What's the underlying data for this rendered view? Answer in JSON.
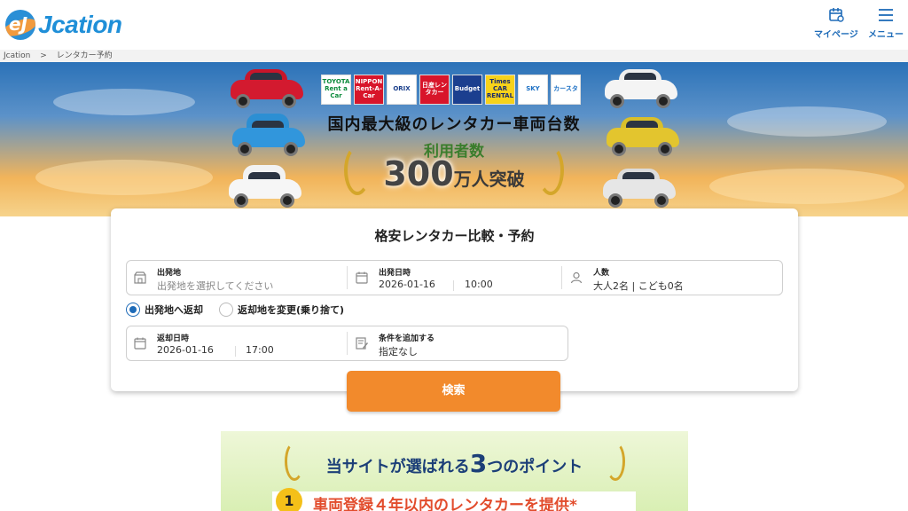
{
  "header": {
    "logo_mark": "eJ",
    "logo_text": "Jcation",
    "mypage_label": "マイページ",
    "menu_label": "メニュー"
  },
  "breadcrumb": {
    "home": "Jcation",
    "sep": ">",
    "current": "レンタカー予約"
  },
  "banner": {
    "brands": [
      "TOYOTA Rent a Car",
      "NIPPON Rent-A-Car",
      "ORIX",
      "日産レンタカー",
      "Budget",
      "Times CAR RENTAL",
      "SKY",
      "カースタ"
    ],
    "title": "国内最大級のレンタカー車両台数",
    "users_label": "利用者数",
    "users_number": "300",
    "users_unit": "万人",
    "users_suffix": "突破"
  },
  "search_form": {
    "title": "格安レンタカー比較・予約",
    "departure_place": {
      "label": "出発地",
      "placeholder": "出発地を選択してください"
    },
    "departure_datetime": {
      "label": "出発日時",
      "date": "2026-01-16",
      "time": "10:00"
    },
    "people": {
      "label": "人数",
      "value": "大人2名 | こども0名"
    },
    "return_options": [
      {
        "label": "出発地へ返却",
        "selected": true
      },
      {
        "label": "返却地を変更(乗り捨て)",
        "selected": false
      }
    ],
    "return_datetime": {
      "label": "返却日時",
      "date": "2026-01-16",
      "time": "17:00"
    },
    "conditions": {
      "label": "条件を追加する",
      "value": "指定なし"
    },
    "search_button": "検索"
  },
  "promo": {
    "title_prefix": "当サイトが選ばれる",
    "title_number": "3",
    "title_suffix": "つのポイント",
    "item1_number": "1",
    "item1_text": "車両登録４年以内のレンタカーを提供*"
  },
  "colors": {
    "accent": "#1e6bb8",
    "search_button": "#f28a2c",
    "logo": "#1f8fd8"
  }
}
